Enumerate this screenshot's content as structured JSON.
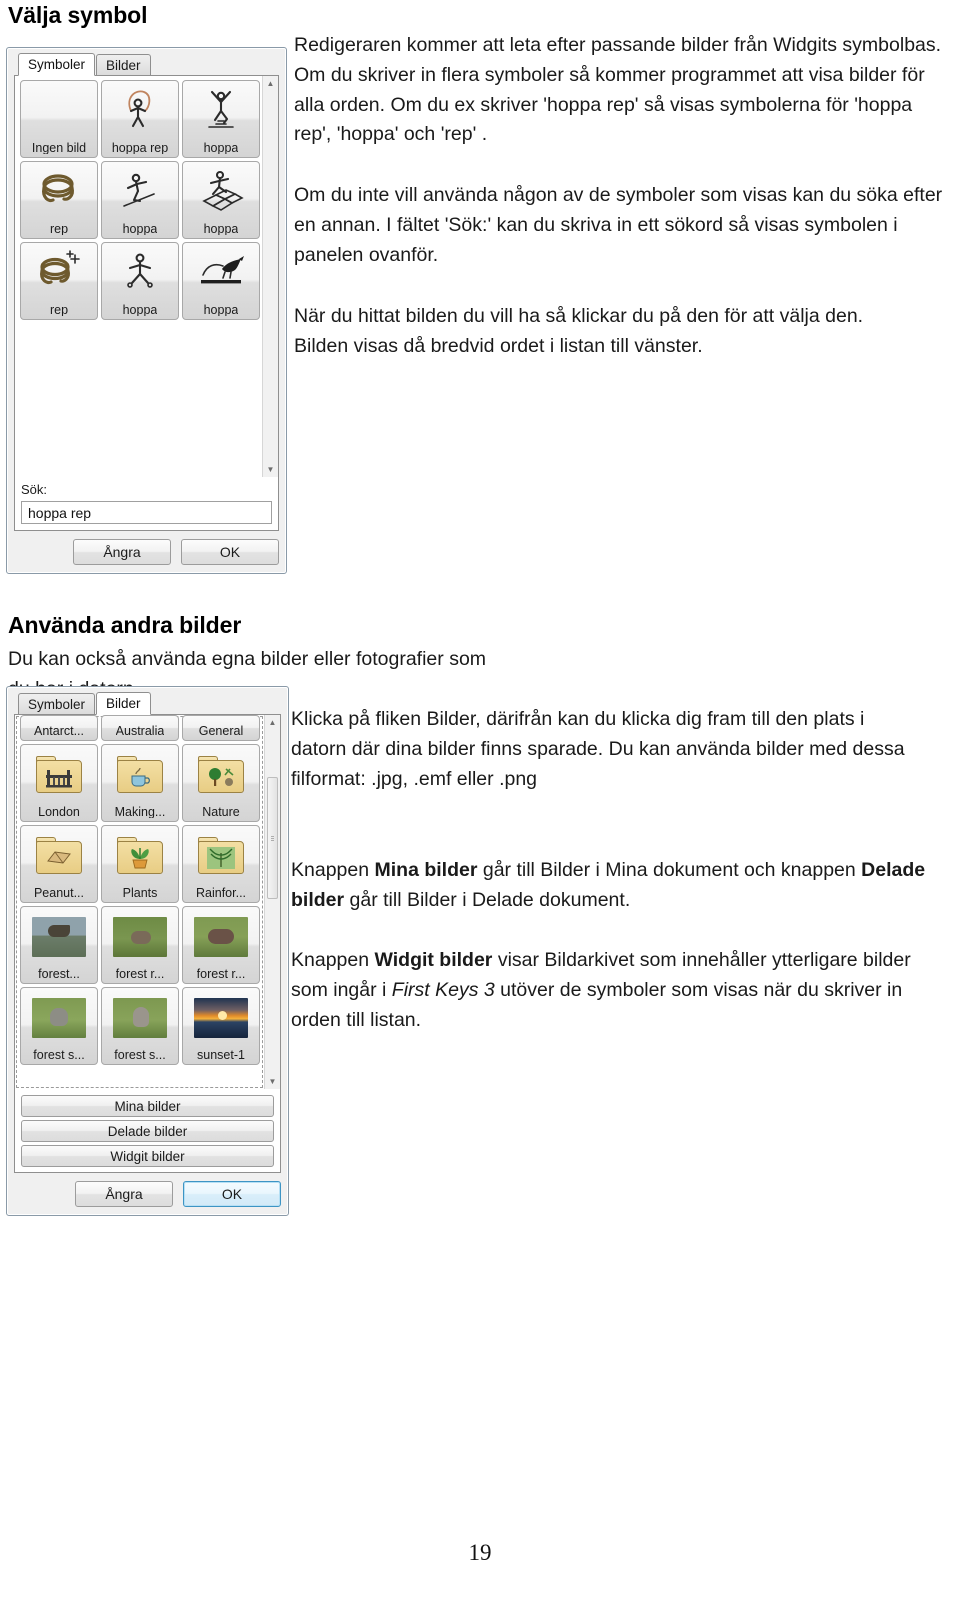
{
  "headings": {
    "valja_symbol": "Välja symbol",
    "anvanda_andra_bilder": "Använda andra bilder"
  },
  "paragraphs": {
    "intro": "Redigeraren kommer att leta efter passande bilder från  Widgits symbolbas. Om du skriver in flera symboler så kommer programmet att visa bilder för alla orden. Om du ex skriver 'hoppa rep' så visas symbolerna för 'hoppa rep', 'hoppa' och 'rep' .",
    "om_du_inte": "Om du inte vill använda någon av de symboler som visas kan du söka efter en annan. I fältet 'Sök:' kan du skriva in ett sökord så visas symbolen i panelen ovanför.",
    "nar_du_hittat": "När du hittat bilden du vill ha så klickar du på den för att välja den. Bilden visas då bredvid ordet i listan till vänster.",
    "du_kan_ocksa": "Du kan också använda egna bilder eller fotografier som du har i datorn.",
    "klicka_pa_fliken": "Klicka på fliken Bilder, därifrån kan du klicka dig fram till den plats i datorn där dina bilder finns sparade. Du kan använda bilder med dessa filformat: .jpg, .emf eller .png",
    "knappen_mina": {
      "part1": "Knappen ",
      "bold1": "Mina bilder",
      "part2": " går till Bilder i Mina dokument och knappen ",
      "bold2": "Delade bilder",
      "part3": " går till Bilder i Delade dokument."
    },
    "knappen_widgit": {
      "part1": "Knappen ",
      "bold1": "Widgit bilder",
      "part2": " visar Bildarkivet som innehåller ytterligare bilder som ingår i ",
      "italic1": "First Keys 3",
      "part3": " utöver de symboler som visas när du skriver in orden till listan."
    }
  },
  "page_number": "19",
  "dialog_symboler": {
    "tabs": [
      {
        "label": "Symboler",
        "active": true
      },
      {
        "label": "Bilder",
        "active": false
      }
    ],
    "tiles": [
      {
        "label": "Ingen bild",
        "art": "none"
      },
      {
        "label": "hoppa rep",
        "art": "jump-rope"
      },
      {
        "label": "hoppa",
        "art": "jump-air"
      },
      {
        "label": "rep",
        "art": "rope-coil"
      },
      {
        "label": "hoppa",
        "art": "jump-crouch"
      },
      {
        "label": "hoppa",
        "art": "hopscotch"
      },
      {
        "label": "rep",
        "art": "rope-coil-plus"
      },
      {
        "label": "hoppa",
        "art": "jump-run"
      },
      {
        "label": "hoppa",
        "art": "jump-animal"
      }
    ],
    "search_label": "Sök:",
    "search_value": "hoppa rep",
    "buttons": {
      "cancel": "Ångra",
      "ok": "OK"
    }
  },
  "dialog_bilder": {
    "tabs": [
      {
        "label": "Symboler",
        "active": false
      },
      {
        "label": "Bilder",
        "active": true
      }
    ],
    "tiles_row_clipped": [
      {
        "label": "Antarct..."
      },
      {
        "label": "Australia"
      },
      {
        "label": "General"
      }
    ],
    "tiles": [
      {
        "label": "London",
        "art": "folder-london"
      },
      {
        "label": "Making...",
        "art": "folder-making"
      },
      {
        "label": "Nature",
        "art": "folder-nature"
      },
      {
        "label": "Peanut...",
        "art": "folder-peanut"
      },
      {
        "label": "Plants",
        "art": "folder-plants"
      },
      {
        "label": "Rainfor...",
        "art": "folder-rainforest"
      },
      {
        "label": "forest...",
        "art": "photo-duck"
      },
      {
        "label": "forest r...",
        "art": "photo-rabbit-1"
      },
      {
        "label": "forest r...",
        "art": "photo-rabbit-2"
      },
      {
        "label": "forest s...",
        "art": "photo-squirrel-1"
      },
      {
        "label": "forest s...",
        "art": "photo-squirrel-2"
      },
      {
        "label": "sunset-1",
        "art": "photo-sunset"
      }
    ],
    "side_buttons": [
      "Mina bilder",
      "Delade bilder",
      "Widgit bilder"
    ],
    "buttons": {
      "cancel": "Ångra",
      "ok": "OK"
    }
  },
  "colors": {
    "dialog_border": "#8a9aa8",
    "dialog_face": "#f0f0f0",
    "default_button_accent": "#3d94c4",
    "folder_yellow": "#e8cd84",
    "rope_brown": "#6e5a2e"
  }
}
